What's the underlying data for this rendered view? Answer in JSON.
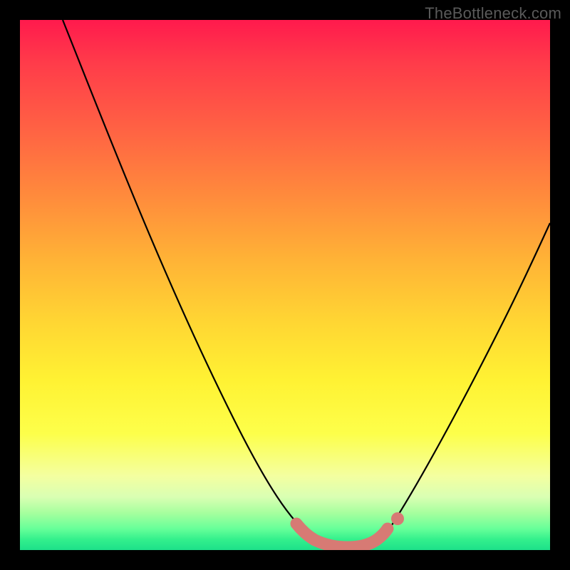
{
  "watermark": "TheBottleneck.com",
  "chart_data": {
    "type": "line",
    "title": "",
    "xlabel": "",
    "ylabel": "",
    "xlim": [
      0,
      100
    ],
    "ylim": [
      0,
      100
    ],
    "grid": false,
    "legend": false,
    "series": [
      {
        "name": "bottleneck-curve",
        "x": [
          8,
          12,
          16,
          20,
          24,
          28,
          32,
          36,
          40,
          44,
          48,
          52,
          54,
          56,
          58,
          60,
          62,
          64,
          66,
          70,
          74,
          78,
          82,
          86,
          90,
          94,
          98,
          100
        ],
        "y": [
          100,
          92,
          84,
          76,
          68,
          60,
          52,
          44,
          36,
          28,
          20,
          12,
          8,
          5,
          3,
          2,
          2,
          2,
          3,
          5,
          10,
          18,
          27,
          36,
          45,
          54,
          62,
          66
        ]
      },
      {
        "name": "highlight-band",
        "x": [
          52,
          54,
          56,
          58,
          60,
          62,
          64,
          66,
          68
        ],
        "y": [
          9,
          6,
          4,
          3,
          2,
          2,
          3,
          4,
          7
        ]
      }
    ],
    "colors": {
      "curve": "#000000",
      "highlight": "#d77a74"
    }
  }
}
